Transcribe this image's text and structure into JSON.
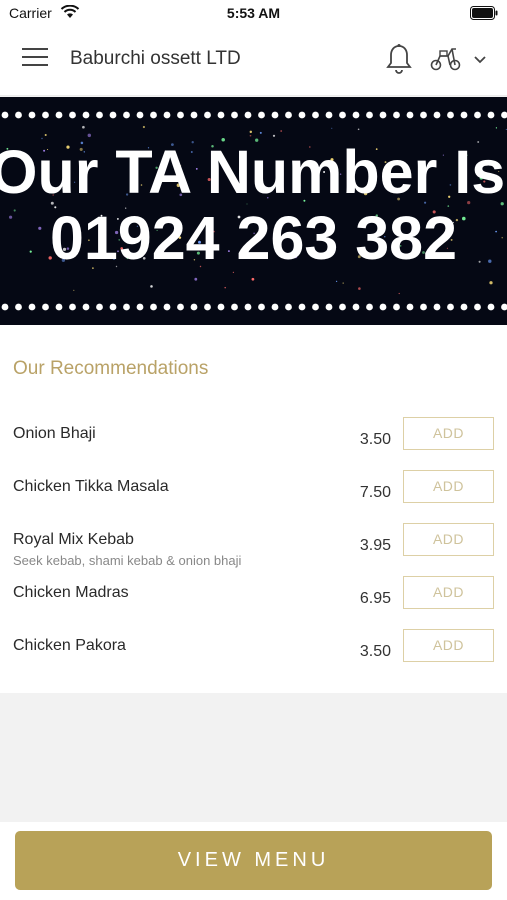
{
  "status_bar": {
    "carrier": "Carrier",
    "time": "5:53 AM"
  },
  "header": {
    "title": "Baburchi ossett LTD",
    "icons": [
      "menu-icon",
      "bell-icon",
      "scooter-icon",
      "chevron-down-icon"
    ]
  },
  "banner": {
    "line1": "Our TA Number Is",
    "line2": "01924 263 382"
  },
  "recommendations": {
    "title": "Our Recommendations",
    "add_label": "ADD",
    "items": [
      {
        "name": "Onion Bhaji",
        "description": "",
        "price": "3.50"
      },
      {
        "name": "Chicken Tikka Masala",
        "description": "",
        "price": "7.50"
      },
      {
        "name": "Royal Mix Kebab",
        "description": "Seek kebab, shami kebab & onion bhaji",
        "price": "3.95"
      },
      {
        "name": "Chicken Madras",
        "description": "",
        "price": "6.95"
      },
      {
        "name": "Chicken Pakora",
        "description": "",
        "price": "3.50"
      }
    ]
  },
  "footer": {
    "view_menu_label": "VIEW MENU"
  },
  "colors": {
    "accent": "#b8a258",
    "accent_text": "#b9a267",
    "add_border": "#ddd0a6"
  }
}
